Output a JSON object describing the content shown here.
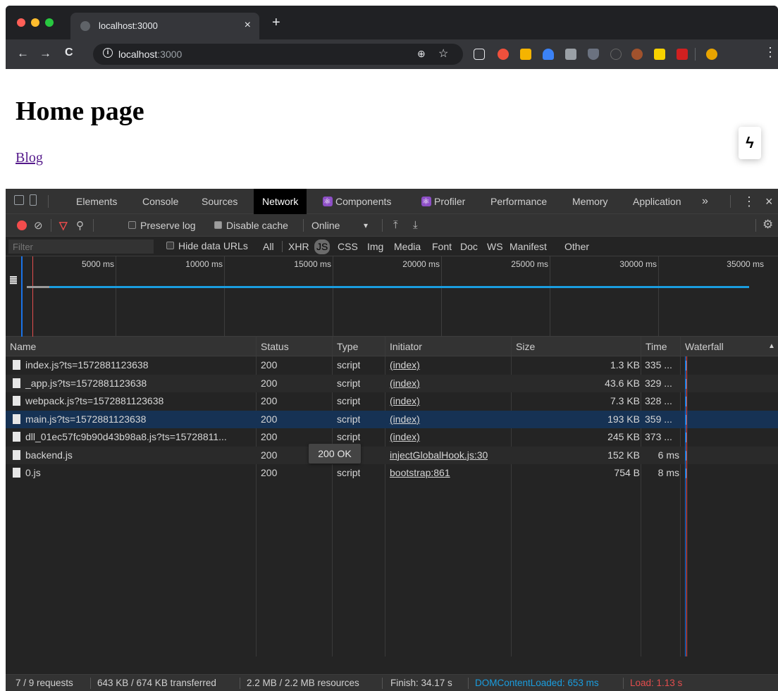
{
  "browser": {
    "tab_title": "localhost:3000",
    "tab_close": "×",
    "new_tab": "+",
    "back": "←",
    "forward": "→",
    "reload": "C",
    "info_glyph": "i",
    "url_host": "localhost",
    "url_port": ":3000",
    "zoom_icon": "⊕",
    "star_icon": "☆",
    "extension_colors": [
      "#ffffff",
      "#f0503c",
      "#f5b400",
      "#3b82f6",
      "#9aa0a6",
      "#6b7280",
      "#444444",
      "#a0522d",
      "#f7d200",
      "#d02020",
      "#e8a400"
    ],
    "menu_icon": "⋮"
  },
  "page": {
    "heading": "Home page",
    "link": "Blog",
    "bolt_icon": "ϟ"
  },
  "devtools": {
    "tabs": [
      {
        "label": "Elements"
      },
      {
        "label": "Console"
      },
      {
        "label": "Sources"
      },
      {
        "label": "Network"
      },
      {
        "label": "Components"
      },
      {
        "label": "Profiler"
      },
      {
        "label": "Performance"
      },
      {
        "label": "Memory"
      },
      {
        "label": "Application"
      }
    ],
    "more_icon": "»",
    "kebab_icon": "⋮",
    "close_icon": "×",
    "toolbar": {
      "clear_icon": "⊘",
      "filter_icon": "▽",
      "search_icon": "⚲",
      "preserve_log": "Preserve log",
      "disable_cache": "Disable cache",
      "throttling": "Online",
      "dropdown": "▾",
      "upload_icon": "⤒",
      "download_icon": "⤓",
      "settings_icon": "⚙"
    },
    "filter": {
      "placeholder": "Filter",
      "hide_data_urls": "Hide data URLs",
      "types": [
        "All",
        "XHR",
        "JS",
        "CSS",
        "Img",
        "Media",
        "Font",
        "Doc",
        "WS",
        "Manifest",
        "Other"
      ],
      "active_type": "JS"
    },
    "overview": {
      "ticks": [
        "5000 ms",
        "10000 ms",
        "15000 ms",
        "20000 ms",
        "25000 ms",
        "30000 ms",
        "35000 ms"
      ]
    },
    "columns": [
      "Name",
      "Status",
      "Type",
      "Initiator",
      "Size",
      "Time",
      "Waterfall"
    ],
    "sort_icon": "▲",
    "rows": [
      {
        "name": "index.js?ts=1572881123638",
        "status": "200",
        "type": "script",
        "initiator": "(index)",
        "size": "1.3 KB",
        "time": "335 ..."
      },
      {
        "name": "_app.js?ts=1572881123638",
        "status": "200",
        "type": "script",
        "initiator": "(index)",
        "size": "43.6 KB",
        "time": "329 ..."
      },
      {
        "name": "webpack.js?ts=1572881123638",
        "status": "200",
        "type": "script",
        "initiator": "(index)",
        "size": "7.3 KB",
        "time": "328 ..."
      },
      {
        "name": "main.js?ts=1572881123638",
        "status": "200",
        "type": "script",
        "initiator": "(index)",
        "size": "193 KB",
        "time": "359 ..."
      },
      {
        "name": "dll_01ec57fc9b90d43b98a8.js?ts=15728811...",
        "status": "200",
        "type": "script",
        "initiator": "(index)",
        "size": "245 KB",
        "time": "373 ..."
      },
      {
        "name": "backend.js",
        "status": "200",
        "type": "script",
        "initiator": "injectGlobalHook.js:30",
        "size": "152 KB",
        "time": "6 ms"
      },
      {
        "name": "0.js",
        "status": "200",
        "type": "script",
        "initiator": "bootstrap:861",
        "size": "754 B",
        "time": "8 ms"
      }
    ],
    "tooltip": "200 OK",
    "status": {
      "requests": "7 / 9 requests",
      "transferred": "643 KB / 674 KB transferred",
      "resources": "2.2 MB / 2.2 MB resources",
      "finish": "Finish: 34.17 s",
      "dom_content_loaded": "DOMContentLoaded: 653 ms",
      "load": "Load: 1.13 s",
      "dcl_color": "#1a9ddf",
      "load_color": "#e34d4d"
    }
  }
}
